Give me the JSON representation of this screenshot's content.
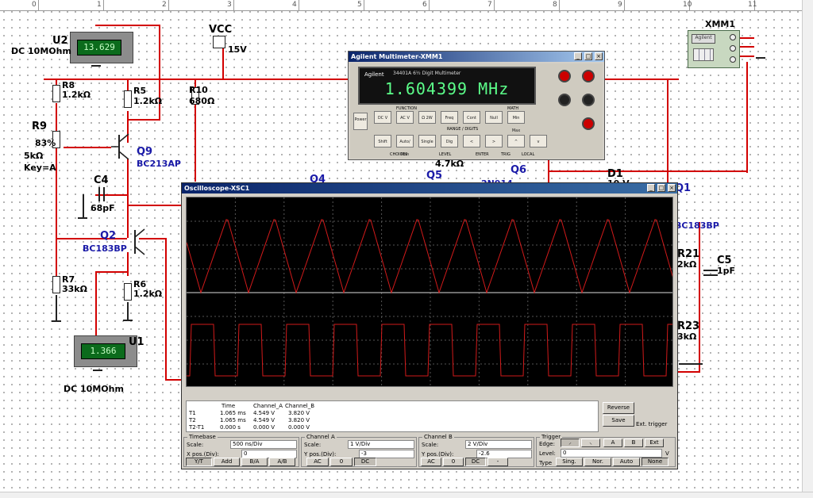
{
  "ruler": {
    "numbers": [
      "0",
      "1",
      "2",
      "3",
      "4",
      "5",
      "6",
      "7",
      "8",
      "9",
      "10",
      "11"
    ]
  },
  "schematic": {
    "u2": {
      "name": "U2",
      "mode": "DC  10MOhm",
      "reading": "13.629"
    },
    "u1": {
      "name": "U1",
      "mode": "DC  10MOhm",
      "reading": "1.366"
    },
    "vcc": {
      "name": "VCC",
      "value": "15V"
    },
    "r8": {
      "name": "R8",
      "value": "1.2kΩ"
    },
    "r9": {
      "name": "R9",
      "percent": "83%",
      "value": "5kΩ",
      "key": "Key=A"
    },
    "r5": {
      "name": "R5",
      "value": "1.2kΩ"
    },
    "r10": {
      "name": "R10",
      "value": "680Ω"
    },
    "q9": {
      "name": "Q9",
      "part": "BC213AP"
    },
    "c4": {
      "name": "C4",
      "value": "68pF"
    },
    "q2": {
      "name": "Q2",
      "part": "BC183BP"
    },
    "r7": {
      "name": "R7",
      "value": "33kΩ"
    },
    "r6": {
      "name": "R6",
      "value": "1.2kΩ"
    },
    "q4": {
      "name": "Q4"
    },
    "q5": {
      "name": "Q5",
      "r_value": "4.7kΩ"
    },
    "q6": {
      "name": "Q6",
      "part_partial": "2N914"
    },
    "d1": {
      "name": "D1",
      "value_partial": "10 V"
    },
    "q1": {
      "name": "Q1",
      "part": "BC183BP"
    },
    "r21": {
      "name": "R21",
      "value": "2kΩ"
    },
    "c5": {
      "name": "C5",
      "value": "1pF"
    },
    "r23": {
      "name": "R23",
      "value": "3kΩ"
    },
    "xmm1": {
      "name": "XMM1",
      "brand": "Agilent"
    }
  },
  "multimeter": {
    "title": "Agilent Multimeter-XMM1",
    "brand": "Agilent",
    "model": "34401A 6½ Digit Multimeter",
    "reading": "1.604399 MHz",
    "power_label": "Power",
    "keys": [
      "DC V",
      "AC V",
      "Ω 2W",
      "Freq",
      "Cont",
      "Null",
      "Min Max",
      "Shift",
      "Auto/ Man",
      "Single",
      "Dig",
      "<",
      ">",
      "^",
      "v"
    ],
    "sections": {
      "function": "FUNCTION",
      "math": "MATH",
      "range": "RANGE / DIGITS",
      "choices": "CHOICES",
      "level": "LEVEL",
      "enter": "ENTER",
      "trig": "TRIG",
      "local": "LOCAL"
    }
  },
  "oscilloscope": {
    "title": "Oscilloscope-XSC1",
    "readout": {
      "headers": [
        "Time",
        "Channel_A",
        "Channel_B"
      ],
      "rows": [
        {
          "label": "T1",
          "time": "1.065 ms",
          "a": "4.549 V",
          "b": "3.820 V"
        },
        {
          "label": "T2",
          "time": "1.065 ms",
          "a": "4.549 V",
          "b": "3.820 V"
        },
        {
          "label": "T2-T1",
          "time": "0.000 s",
          "a": "0.000 V",
          "b": "0.000 V"
        }
      ]
    },
    "buttons": {
      "reverse": "Reverse",
      "save": "Save",
      "ext_trigger": "Ext. trigger"
    },
    "timebase": {
      "title": "Timebase",
      "scale_label": "Scale:",
      "scale": "500 ns/Div",
      "xpos_label": "X pos.(Div):",
      "xpos": "0",
      "modes": [
        "Y/T",
        "Add",
        "B/A",
        "A/B"
      ]
    },
    "channel_a": {
      "title": "Channel A",
      "scale_label": "Scale:",
      "scale": "1  V/Div",
      "ypos_label": "Y pos.(Div):",
      "ypos": "-3",
      "coupling": [
        "AC",
        "0",
        "DC"
      ]
    },
    "channel_b": {
      "title": "Channel B",
      "scale_label": "Scale:",
      "scale": "2  V/Div",
      "ypos_label": "Y pos.(Div):",
      "ypos": "-2.6",
      "coupling": [
        "AC",
        "0",
        "DC",
        "-"
      ]
    },
    "trigger": {
      "title": "Trigger",
      "edge_label": "Edge:",
      "edge_sources": [
        "A",
        "B",
        "Ext"
      ],
      "level_label": "Level:",
      "level": "0",
      "level_unit": "V",
      "type_label": "Type",
      "types": [
        "Sing.",
        "Nor.",
        "Auto",
        "None"
      ]
    }
  },
  "colors": {
    "wire": "#d20000",
    "trace": "#d11a1a",
    "screen": "#000000"
  }
}
